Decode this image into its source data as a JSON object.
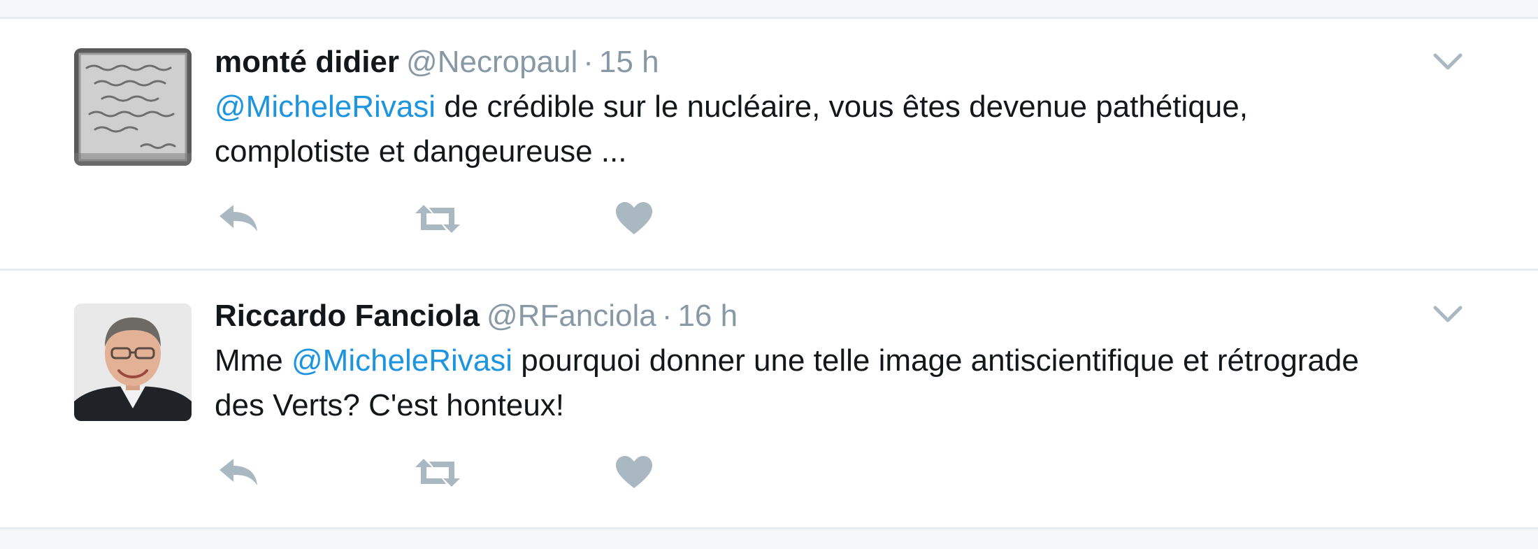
{
  "tweets": [
    {
      "fullname": "monté didier",
      "username": "@Necropaul",
      "separator": "·",
      "time": "15 h",
      "body": {
        "prefix": "",
        "mention": "@MicheleRivasi",
        "suffix": " de crédible sur le nucléaire, vous êtes devenue pathétique, complotiste et dangeureuse ..."
      },
      "avatar_icon": "photo-quote-avatar",
      "actions": [
        "reply-icon",
        "retweet-icon",
        "like-icon"
      ]
    },
    {
      "fullname": "Riccardo Fanciola",
      "username": "@RFanciola",
      "separator": "·",
      "time": "16 h",
      "body": {
        "prefix": "Mme ",
        "mention": "@MicheleRivasi",
        "suffix": " pourquoi donner une telle image antiscientifique et rétrograde des Verts? C'est honteux!"
      },
      "avatar_icon": "photo-man-avatar",
      "actions": [
        "reply-icon",
        "retweet-icon",
        "like-icon"
      ]
    }
  ],
  "colors": {
    "name": "#14171a",
    "meta": "#8899a6",
    "mention": "#1b95e0",
    "icon": "#aab8c2",
    "divider": "#e6ecf0"
  }
}
